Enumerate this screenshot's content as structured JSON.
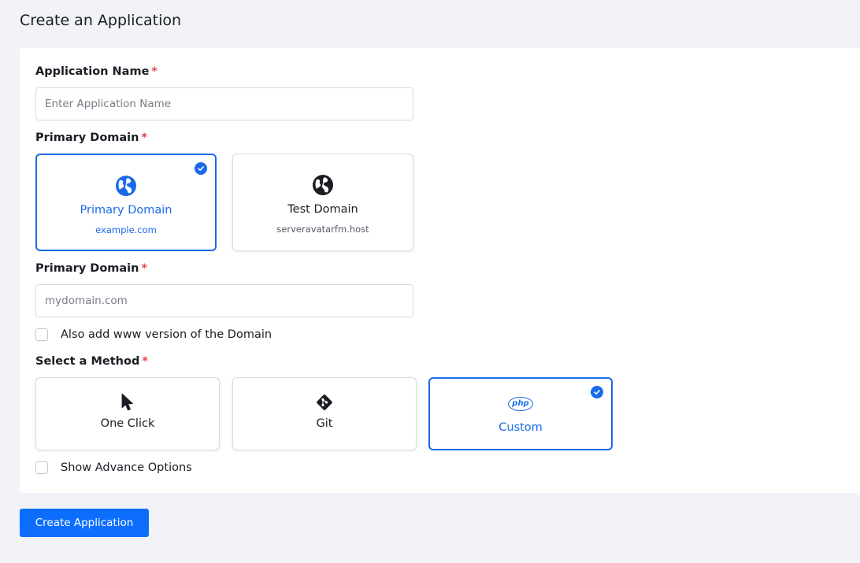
{
  "page": {
    "title": "Create an Application"
  },
  "form": {
    "app_name": {
      "label": "Application Name",
      "required_mark": "*",
      "placeholder": "Enter Application Name",
      "value": ""
    },
    "domain_type": {
      "label": "Primary Domain",
      "required_mark": "*",
      "options": [
        {
          "title": "Primary Domain",
          "subtitle": "example.com",
          "icon": "globe-icon",
          "selected": true
        },
        {
          "title": "Test Domain",
          "subtitle": "serveravatarfm.host",
          "icon": "globe-icon",
          "selected": false
        }
      ]
    },
    "primary_domain": {
      "label": "Primary Domain",
      "required_mark": "*",
      "placeholder": "mydomain.com",
      "value": ""
    },
    "www_checkbox": {
      "label": "Also add www version of the Domain",
      "checked": false
    },
    "method": {
      "label": "Select a Method",
      "required_mark": "*",
      "options": [
        {
          "title": "One Click",
          "icon": "cursor-pointer-icon",
          "selected": false
        },
        {
          "title": "Git",
          "icon": "git-icon",
          "selected": false
        },
        {
          "title": "Custom",
          "icon": "php-icon",
          "icon_text": "php",
          "selected": true
        }
      ]
    },
    "advance_checkbox": {
      "label": "Show Advance Options",
      "checked": false
    }
  },
  "actions": {
    "submit_label": "Create Application"
  },
  "colors": {
    "accent": "#1a6ae8",
    "button": "#0d6efd",
    "required": "#e5484d",
    "background": "#f1f3f8"
  }
}
